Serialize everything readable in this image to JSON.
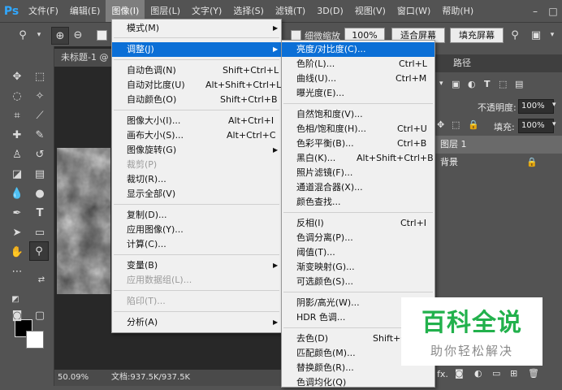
{
  "app": {
    "logo": "Ps"
  },
  "menubar": {
    "items": [
      "文件(F)",
      "编辑(E)",
      "图像(I)",
      "图层(L)",
      "文字(Y)",
      "选择(S)",
      "滤镜(T)",
      "3D(D)",
      "视图(V)",
      "窗口(W)",
      "帮助(H)"
    ],
    "active": "图像(I)"
  },
  "options_bar": {
    "zoom_icon": "zoom-icon",
    "checkbox_label": "细微缩放",
    "zoom_percent": "100%",
    "fit_screen": "适合屏幕",
    "fill_screen": "填充屏幕"
  },
  "document": {
    "tab_title": "未标题-1 @",
    "zoom": "50.09%",
    "doc_info": "文档:937.5K/937.5K"
  },
  "right_panel": {
    "tab_paths": "路径",
    "opacity_label": "不透明度:",
    "opacity_value": "100%",
    "fill_label": "填充:",
    "fill_value": "100%",
    "layers": [
      "图层 1",
      "背景"
    ]
  },
  "image_menu": {
    "items": [
      {
        "label": "模式(M)",
        "shortcut": "",
        "submenu": true
      },
      {
        "label": "调整(J)",
        "shortcut": "",
        "submenu": true,
        "highlighted": true
      },
      {
        "label": "自动色调(N)",
        "shortcut": "Shift+Ctrl+L"
      },
      {
        "label": "自动对比度(U)",
        "shortcut": "Alt+Shift+Ctrl+L"
      },
      {
        "label": "自动颜色(O)",
        "shortcut": "Shift+Ctrl+B"
      },
      {
        "label": "图像大小(I)...",
        "shortcut": "Alt+Ctrl+I"
      },
      {
        "label": "画布大小(S)...",
        "shortcut": "Alt+Ctrl+C"
      },
      {
        "label": "图像旋转(G)",
        "shortcut": "",
        "submenu": true
      },
      {
        "label": "裁剪(P)",
        "shortcut": "",
        "disabled": true
      },
      {
        "label": "裁切(R)...",
        "shortcut": ""
      },
      {
        "label": "显示全部(V)",
        "shortcut": ""
      },
      {
        "label": "复制(D)...",
        "shortcut": ""
      },
      {
        "label": "应用图像(Y)...",
        "shortcut": ""
      },
      {
        "label": "计算(C)...",
        "shortcut": ""
      },
      {
        "label": "变量(B)",
        "shortcut": "",
        "submenu": true
      },
      {
        "label": "应用数据组(L)...",
        "shortcut": "",
        "disabled": true
      },
      {
        "label": "陷印(T)...",
        "shortcut": "",
        "disabled": true
      },
      {
        "label": "分析(A)",
        "shortcut": "",
        "submenu": true
      }
    ]
  },
  "adjust_menu": {
    "items": [
      {
        "label": "亮度/对比度(C)...",
        "shortcut": "",
        "highlighted": true
      },
      {
        "label": "色阶(L)...",
        "shortcut": "Ctrl+L"
      },
      {
        "label": "曲线(U)...",
        "shortcut": "Ctrl+M"
      },
      {
        "label": "曝光度(E)...",
        "shortcut": ""
      },
      {
        "label": "自然饱和度(V)...",
        "shortcut": ""
      },
      {
        "label": "色相/饱和度(H)...",
        "shortcut": "Ctrl+U"
      },
      {
        "label": "色彩平衡(B)...",
        "shortcut": "Ctrl+B"
      },
      {
        "label": "黑白(K)...",
        "shortcut": "Alt+Shift+Ctrl+B"
      },
      {
        "label": "照片滤镜(F)...",
        "shortcut": ""
      },
      {
        "label": "通道混合器(X)...",
        "shortcut": ""
      },
      {
        "label": "颜色查找...",
        "shortcut": ""
      },
      {
        "label": "反相(I)",
        "shortcut": "Ctrl+I"
      },
      {
        "label": "色调分离(P)...",
        "shortcut": ""
      },
      {
        "label": "阈值(T)...",
        "shortcut": ""
      },
      {
        "label": "渐变映射(G)...",
        "shortcut": ""
      },
      {
        "label": "可选颜色(S)...",
        "shortcut": ""
      },
      {
        "label": "阴影/高光(W)...",
        "shortcut": ""
      },
      {
        "label": "HDR 色调...",
        "shortcut": ""
      },
      {
        "label": "去色(D)",
        "shortcut": "Shift+Ctrl+U"
      },
      {
        "label": "匹配颜色(M)...",
        "shortcut": ""
      },
      {
        "label": "替换颜色(R)...",
        "shortcut": ""
      },
      {
        "label": "色调均化(Q)",
        "shortcut": ""
      }
    ]
  },
  "watermark": {
    "title": "百科全说",
    "subtitle": "助你轻松解决"
  },
  "colors": {
    "highlight": "#0b6fd6",
    "menu_bg": "#f0f0f0",
    "ui_bg": "#535353",
    "watermark_green": "#22b14c"
  }
}
